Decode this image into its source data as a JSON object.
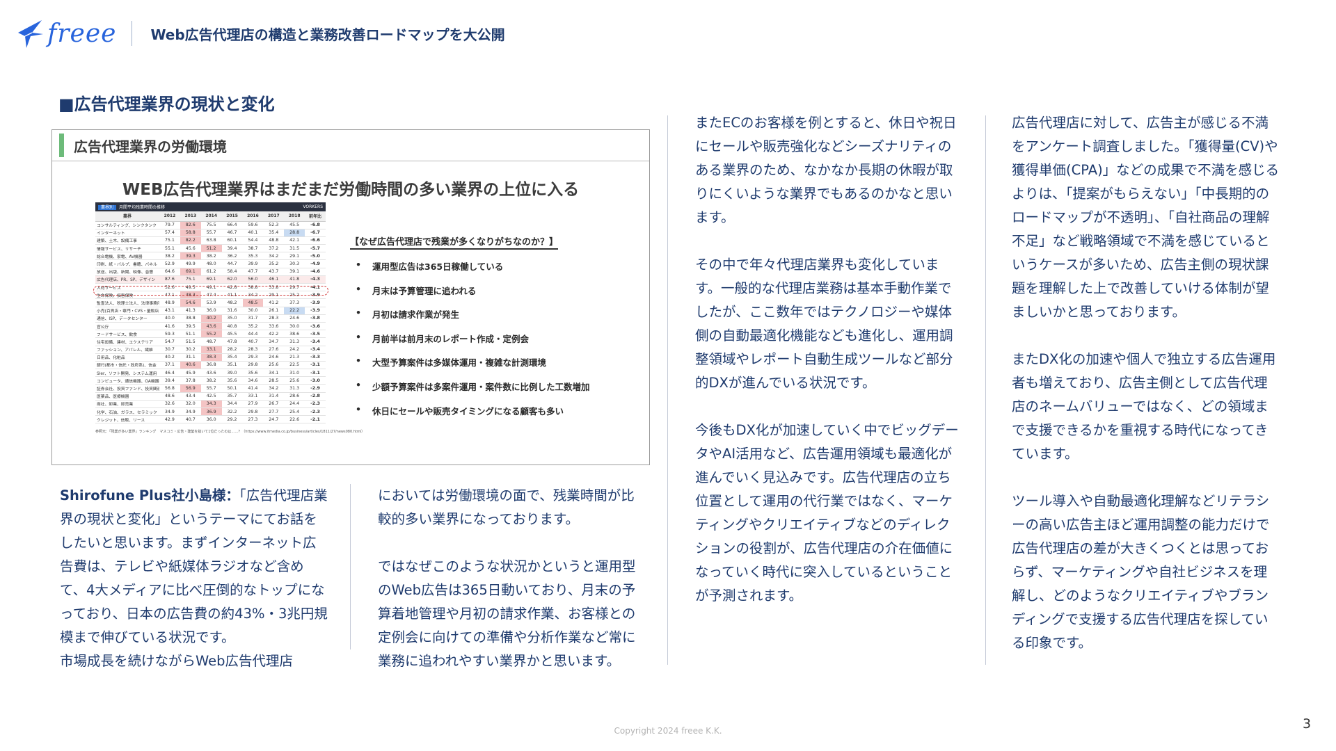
{
  "header": {
    "logo_text": "freee",
    "title": "Web広告代理店の構造と業務改善ロードマップを大公開"
  },
  "section_title": "■広告代理業界の現状と変化",
  "figure": {
    "label": "広告代理業界の労働環境",
    "headline": "WEB広告代理業界はまだまだ労働時間の多い業界の上位に入る",
    "table": {
      "tag": "業界別",
      "title": "月間平均残業時間の推移",
      "brand": "VORKERS",
      "columns": [
        "業界",
        "2012",
        "2013",
        "2014",
        "2015",
        "2016",
        "2017",
        "2018",
        "前年比"
      ],
      "rows": [
        {
          "name": "コンサルティング、シンクタンク",
          "values": [
            "79.7",
            "82.6",
            "75.5",
            "66.4",
            "59.6",
            "52.3",
            "45.5",
            "-6.8"
          ],
          "hot": [
            1
          ],
          "cool": []
        },
        {
          "name": "インターネット",
          "values": [
            "57.4",
            "58.8",
            "55.7",
            "46.7",
            "40.1",
            "35.4",
            "28.8",
            "-6.7"
          ],
          "hot": [
            1
          ],
          "cool": [
            6
          ]
        },
        {
          "name": "建築、土木、設備工事",
          "values": [
            "75.1",
            "82.2",
            "63.8",
            "60.1",
            "54.4",
            "48.8",
            "42.1",
            "-6.6"
          ],
          "hot": [
            1
          ],
          "cool": []
        },
        {
          "name": "情報サービス、リサーチ",
          "values": [
            "55.1",
            "45.6",
            "51.2",
            "39.4",
            "38.7",
            "37.2",
            "31.5",
            "-5.7"
          ],
          "hot": [
            2
          ],
          "cool": []
        },
        {
          "name": "総合電機、家電、AV機器",
          "values": [
            "38.2",
            "39.3",
            "38.2",
            "36.2",
            "35.3",
            "34.2",
            "29.1",
            "-5.0"
          ],
          "hot": [
            1
          ],
          "cool": []
        },
        {
          "name": "印刷、紙・パルプ、書籍、パネル",
          "values": [
            "52.9",
            "49.9",
            "48.0",
            "44.7",
            "39.9",
            "35.2",
            "30.3",
            "-4.9"
          ],
          "hot": [],
          "cool": []
        },
        {
          "name": "放送、出版、新聞、映像、音響",
          "values": [
            "64.6",
            "69.1",
            "61.2",
            "58.4",
            "47.7",
            "43.7",
            "39.1",
            "-4.6"
          ],
          "hot": [
            1
          ],
          "cool": []
        },
        {
          "name": "広告代理店、PR、SP、デザイン",
          "values": [
            "87.6",
            "75.1",
            "69.1",
            "62.0",
            "56.0",
            "46.1",
            "41.8",
            "-4.3"
          ],
          "hot": [
            1
          ],
          "cool": [],
          "highlight": true
        },
        {
          "name": "人材サービス",
          "values": [
            "52.6",
            "49.5",
            "49.1",
            "42.8",
            "38.8",
            "33.8",
            "29.7",
            "-4.1"
          ],
          "hot": [],
          "cool": []
        },
        {
          "name": "生命保険、損害保険",
          "values": [
            "47.1",
            "48.3",
            "47.4",
            "41.1",
            "34.2",
            "29.1",
            "25.2",
            "-3.9"
          ],
          "hot": [
            1
          ],
          "cool": []
        },
        {
          "name": "監査法人、税理士法人、法律事務所",
          "values": [
            "48.9",
            "54.6",
            "53.9",
            "48.2",
            "48.5",
            "41.2",
            "37.3",
            "-3.9"
          ],
          "hot": [
            1,
            4
          ],
          "cool": []
        },
        {
          "name": "小売(百貨店・専門・CVS・量販店)",
          "values": [
            "43.1",
            "41.3",
            "36.0",
            "31.6",
            "30.0",
            "26.1",
            "22.2",
            "-3.9"
          ],
          "hot": [],
          "cool": [
            6
          ]
        },
        {
          "name": "通信、ISP、データセンター",
          "values": [
            "40.0",
            "38.8",
            "40.2",
            "35.0",
            "31.7",
            "28.3",
            "24.6",
            "-3.8"
          ],
          "hot": [
            2
          ],
          "cool": []
        },
        {
          "name": "官公庁",
          "values": [
            "41.6",
            "39.5",
            "43.6",
            "40.8",
            "35.2",
            "33.6",
            "30.0",
            "-3.6"
          ],
          "hot": [
            2
          ],
          "cool": []
        },
        {
          "name": "フードサービス、飲食",
          "values": [
            "59.3",
            "51.1",
            "55.2",
            "45.5",
            "44.4",
            "42.2",
            "38.6",
            "-3.5"
          ],
          "hot": [
            2
          ],
          "cool": []
        },
        {
          "name": "住宅設備、建材、エクステリア",
          "values": [
            "54.7",
            "51.5",
            "48.7",
            "47.8",
            "40.7",
            "34.7",
            "31.3",
            "-3.4"
          ],
          "hot": [],
          "cool": []
        },
        {
          "name": "ファッション、アパレル、繊維",
          "values": [
            "30.7",
            "30.2",
            "33.1",
            "28.2",
            "28.3",
            "27.6",
            "24.2",
            "-3.4"
          ],
          "hot": [
            2
          ],
          "cool": []
        },
        {
          "name": "日用品、化粧品",
          "values": [
            "40.2",
            "31.1",
            "38.3",
            "35.4",
            "29.3",
            "24.6",
            "21.3",
            "-3.3"
          ],
          "hot": [
            2
          ],
          "cool": []
        },
        {
          "name": "銀行(都市・信託・政府系)、信金",
          "values": [
            "37.1",
            "40.6",
            "36.8",
            "35.1",
            "29.8",
            "25.6",
            "22.5",
            "-3.1"
          ],
          "hot": [
            1
          ],
          "cool": []
        },
        {
          "name": "SIer、ソフト開発、システム運用",
          "values": [
            "46.4",
            "45.9",
            "43.6",
            "39.0",
            "35.6",
            "34.1",
            "31.0",
            "-3.1"
          ],
          "hot": [],
          "cool": []
        },
        {
          "name": "コンピュータ、通信機器、OA機器関連",
          "values": [
            "39.4",
            "37.8",
            "38.2",
            "35.6",
            "34.6",
            "28.5",
            "25.6",
            "-3.0"
          ],
          "hot": [],
          "cool": []
        },
        {
          "name": "証券会社、投資ファンド、投資関連",
          "values": [
            "56.8",
            "56.9",
            "55.7",
            "50.1",
            "41.4",
            "34.2",
            "31.3",
            "-2.9"
          ],
          "hot": [
            1
          ],
          "cool": []
        },
        {
          "name": "医薬品、医療機器",
          "values": [
            "48.6",
            "43.4",
            "42.5",
            "35.7",
            "33.1",
            "31.4",
            "28.6",
            "-2.8"
          ],
          "hot": [],
          "cool": []
        },
        {
          "name": "商社、卸業、卸売業",
          "values": [
            "32.6",
            "32.0",
            "34.3",
            "34.4",
            "27.9",
            "26.7",
            "24.4",
            "-2.3"
          ],
          "hot": [
            2
          ],
          "cool": []
        },
        {
          "name": "化学、石油、ガラス、セラミック",
          "values": [
            "34.9",
            "34.9",
            "36.9",
            "32.2",
            "29.8",
            "27.7",
            "25.4",
            "-2.3"
          ],
          "hot": [
            2
          ],
          "cool": []
        },
        {
          "name": "クレジット、信販、リース",
          "values": [
            "42.9",
            "40.7",
            "36.0",
            "29.2",
            "27.3",
            "24.7",
            "22.6",
            "-2.1"
          ],
          "hot": [],
          "cool": []
        }
      ],
      "source": "参照元：「残業が多い業界」ランキング　マスコミ・広告・建築を抜いて1位だったのは……？（https://www.itmedia.co.jp/business/articles/1811/27/news080.html）"
    },
    "reasons_title": "【なぜ広告代理店で残業が多くなりがちなのか？】",
    "reasons": [
      "運用型広告は365日稼働している",
      "月末は予算管理に追われる",
      "月初は請求作業が発生",
      "月前半は前月末のレポート作成・定例会",
      "大型予算案件は多媒体運用・複雑な計測環境",
      "少額予算案件は多案件運用・案件数に比例した工数増加",
      "休日にセールや販売タイミングになる顧客も多い"
    ]
  },
  "columns": {
    "a": {
      "speaker": "Shirofune Plus社小島様：",
      "p1": "「広告代理店業界の現状と変化」というテーマにてお話をしたいと思います。まずインターネット広告費は、テレビや紙媒体ラジオなど含めて、4大メディアに比べ圧倒的なトップになっており、日本の広告費の約43%・3兆円規模まで伸びている状況です。",
      "p2": "市場成長を続けながらWeb広告代理店"
    },
    "b": {
      "p1": "においては労働環境の面で、残業時間が比較的多い業界になっております。",
      "p2": "ではなぜこのような状況かというと運用型のWeb広告は365日動いており、月末の予算着地管理や月初の請求作業、お客様との定例会に向けての準備や分析作業など常に業務に追われやすい業界かと思います。"
    },
    "c": {
      "p1": "またECのお客様を例とすると、休日や祝日にセールや販売強化などシーズナリティのある業界のため、なかなか長期の休暇が取りにくいような業界でもあるのかなと思います。",
      "p2": "その中で年々代理店業界も変化しています。一般的な代理店業務は基本手動作業でしたが、ここ数年ではテクノロジーや媒体側の自動最適化機能なども進化し、運用調整領域やレポート自動生成ツールなど部分的DXが進んでいる状況です。",
      "p3": "今後もDX化が加速していく中でビッグデータやAI活用など、広告運用領域も最適化が進んでいく見込みです。広告代理店の立ち位置として運用の代行業ではなく、マーケティングやクリエイティブなどのディレクションの役割が、広告代理店の介在価値になっていく時代に突入しているということが予測されます。"
    },
    "d": {
      "p1": "広告代理店に対して、広告主が感じる不満をアンケート調査しました。「獲得量(CV)や獲得単価(CPA)」などの成果で不満を感じるよりは、「提案がもらえない」「中長期的のロードマップが不透明」、「自社商品の理解不足」など戦略領域で不満を感じているというケースが多いため、広告主側の現状課題を理解した上で改善していける体制が望ましいかと思っております。",
      "p2": "またDX化の加速や個人で独立する広告運用者も増えており、広告主側として広告代理店のネームバリューではなく、どの領域まで支援できるかを重視する時代になってきています。",
      "p3": "ツール導入や自動最適化理解などリテラシーの高い広告主ほど運用調整の能力だけで広告代理店の差が大きくつくとは思っておらず、マーケティングや自社ビジネスを理解し、どのようなクリエイティブやブランディングで支援する広告代理店を探している印象です。"
    }
  },
  "footer": {
    "copyright": "Copyright 2024 freee K.K.",
    "page_number": "3"
  },
  "colors": {
    "text": "#1f3b6e",
    "brand": "#2864dc",
    "accent_green": "#6dbb7a",
    "hot_cell": "#f4c4c4",
    "cool_cell": "#c8dbf2"
  }
}
